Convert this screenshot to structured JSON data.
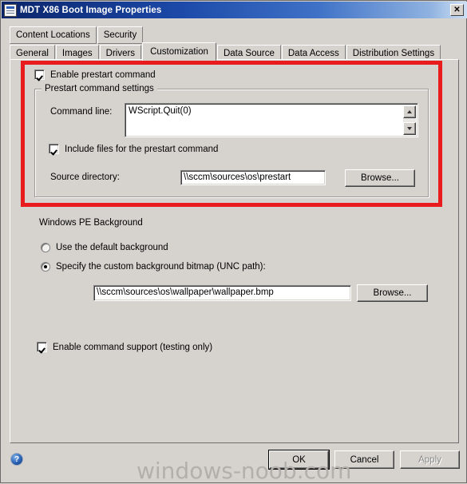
{
  "window": {
    "title": "MDT X86 Boot Image Properties",
    "icon": "document-properties-icon",
    "close_label": "✕"
  },
  "tabs": {
    "row1": [
      {
        "label": "Content Locations",
        "selected": false
      },
      {
        "label": "Security",
        "selected": false
      }
    ],
    "row2": [
      {
        "label": "General",
        "selected": false
      },
      {
        "label": "Images",
        "selected": false
      },
      {
        "label": "Drivers",
        "selected": false
      },
      {
        "label": "Customization",
        "selected": true
      },
      {
        "label": "Data Source",
        "selected": false
      },
      {
        "label": "Data Access",
        "selected": false
      },
      {
        "label": "Distribution Settings",
        "selected": false
      }
    ]
  },
  "highlight": {
    "color": "#e81c1c"
  },
  "prestart": {
    "enable_label": "Enable prestart command",
    "enable_checked": true,
    "group_title": "Prestart command settings",
    "command_line_label": "Command line:",
    "command_line_value": "WScript.Quit(0)",
    "include_files_label": "Include files for the prestart command",
    "include_files_checked": true,
    "source_directory_label": "Source directory:",
    "source_directory_value": "\\\\sccm\\sources\\os\\prestart",
    "browse_label": "Browse..."
  },
  "winpe_background": {
    "section_label": "Windows PE Background",
    "option_default_label": "Use the default background",
    "option_default_selected": false,
    "option_custom_label": "Specify the custom background bitmap (UNC path):",
    "option_custom_selected": true,
    "bitmap_path_value": "\\\\sccm\\sources\\os\\wallpaper\\wallpaper.bmp",
    "browse_label": "Browse..."
  },
  "command_support": {
    "label": "Enable command support (testing only)",
    "checked": true
  },
  "footer": {
    "help_glyph": "?",
    "ok_label": "OK",
    "cancel_label": "Cancel",
    "apply_label": "Apply",
    "apply_disabled": true
  },
  "watermark": {
    "text": "windows-noob.com"
  }
}
